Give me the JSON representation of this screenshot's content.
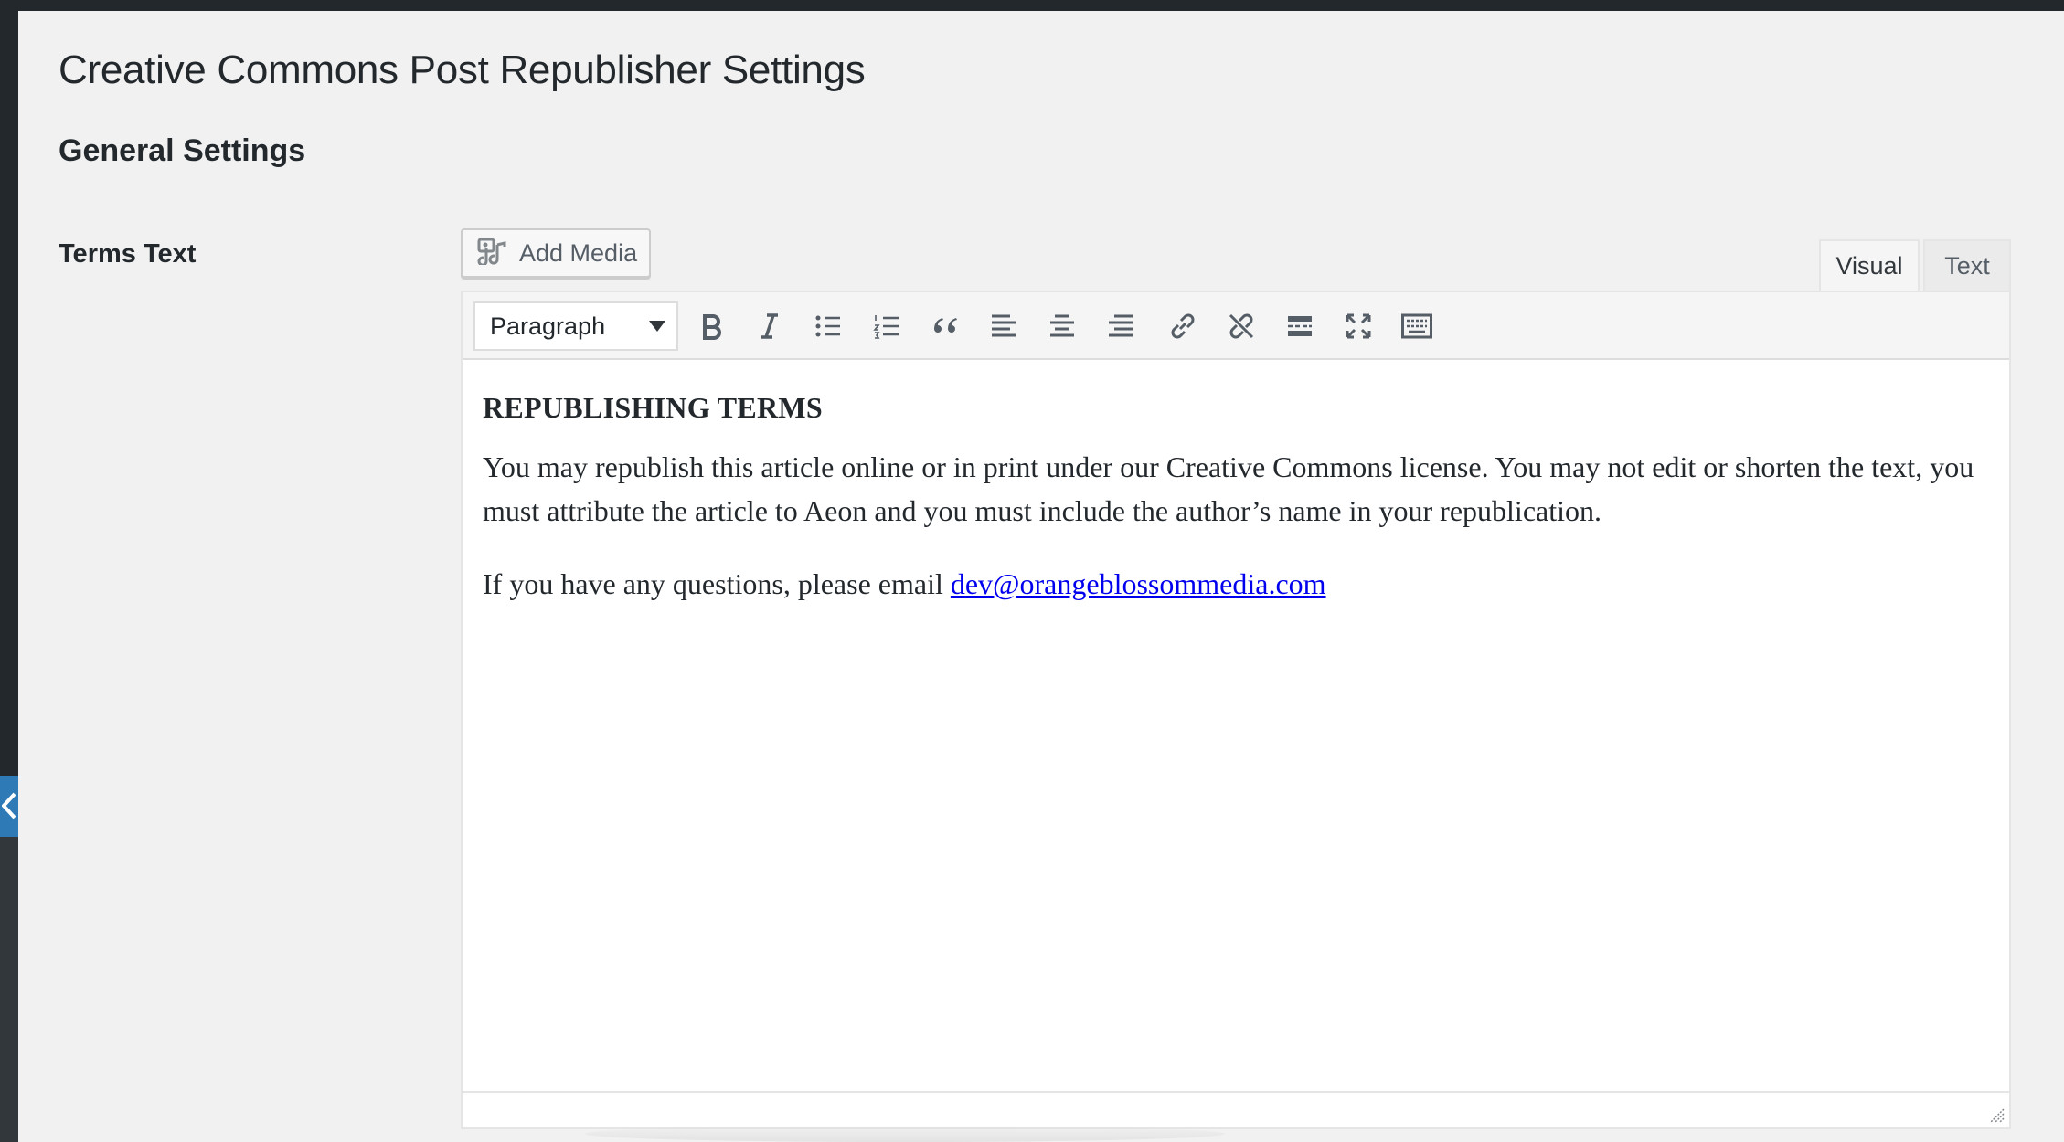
{
  "page": {
    "title": "Creative Commons Post Republisher Settings",
    "section_title": "General Settings"
  },
  "field": {
    "label": "Terms Text"
  },
  "add_media": {
    "label": "Add Media",
    "icon": "add-media-icon"
  },
  "tabs": {
    "visual": "Visual",
    "text": "Text",
    "active": "Visual"
  },
  "toolbar": {
    "format_value": "Paragraph",
    "buttons": [
      "bold",
      "italic",
      "bulleted-list",
      "numbered-list",
      "blockquote",
      "align-left",
      "align-center",
      "align-right",
      "insert-link",
      "remove-link",
      "read-more",
      "fullscreen",
      "toolbar-toggle"
    ]
  },
  "content": {
    "heading": "REPUBLISHING TERMS",
    "paragraph1": "You may republish this article online or in print under our Creative Commons license. You may not edit or shorten the text, you must attribute the article to Aeon and you must include the author’s name in your republication.",
    "contact_prefix": "If you have any questions, please email ",
    "contact_email": "dev@orangeblossommedia.com"
  },
  "colors": {
    "admin_dark": "#23282d",
    "accent_blue": "#2e7ab6",
    "page_bg": "#f1f1f1",
    "link": "#0000ee"
  }
}
